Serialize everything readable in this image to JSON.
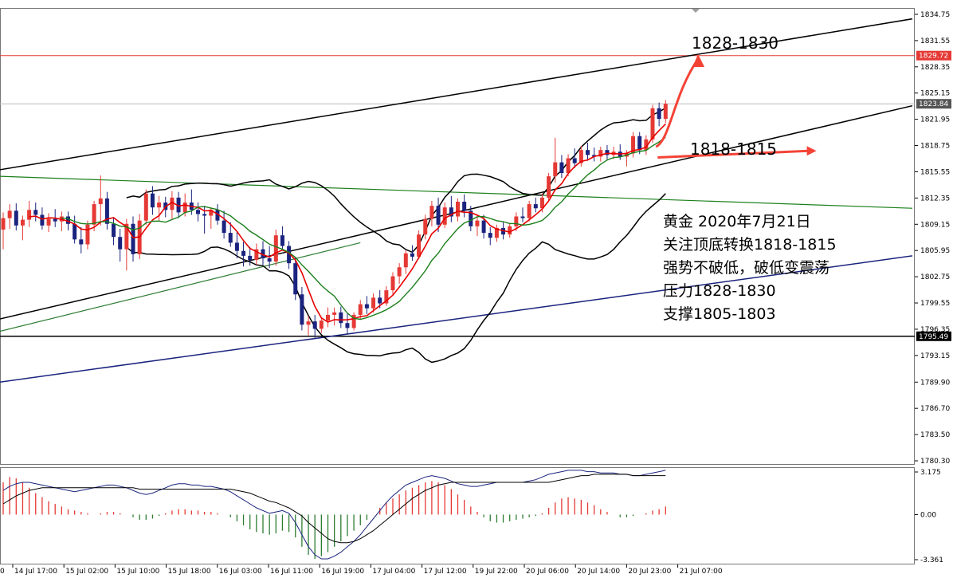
{
  "chart_data": {
    "type": "candlestick",
    "instrument_note": "黄金 2020年7月21日",
    "price_axis": {
      "ticks": [
        "1834.75",
        "1831.55",
        "1828.35",
        "1825.15",
        "1821.95",
        "1818.75",
        "1815.55",
        "1812.35",
        "1809.15",
        "1805.95",
        "1802.75",
        "1799.55",
        "1796.35",
        "1793.15",
        "1789.90",
        "1786.70",
        "1783.50",
        "1780.30"
      ],
      "range": [
        1780.3,
        1834.75
      ]
    },
    "time_axis": {
      "ticks": [
        "14 Jul 17:00",
        "15 Jul 02:00",
        "15 Jul 10:00",
        "15 Jul 18:00",
        "16 Jul 03:00",
        "16 Jul 11:00",
        "16 Jul 19:00",
        "17 Jul 04:00",
        "17 Jul 12:00",
        "19 Jul 22:00",
        "20 Jul 06:00",
        "20 Jul 14:00",
        "20 Jul 23:00",
        "21 Jul 07:00"
      ],
      "first_partial": "0"
    },
    "price_tags": [
      {
        "label": "1829.72",
        "value": 1829.72,
        "color": "#e53935"
      },
      {
        "label": "1823.84",
        "value": 1823.84,
        "color": "#555555"
      },
      {
        "label": "1795.49",
        "value": 1795.49,
        "color": "#000000"
      }
    ],
    "horizontal_lines": [
      {
        "value": 1829.72,
        "color": "#e53935"
      },
      {
        "value": 1823.84,
        "color": "#bbbbbb"
      },
      {
        "value": 1795.49,
        "color": "#000000"
      }
    ],
    "candles": [
      [
        1808.5,
        1810.6,
        1806.1,
        1809.9
      ],
      [
        1809.9,
        1811.6,
        1808.6,
        1810.8
      ],
      [
        1810.8,
        1811.7,
        1808.4,
        1809.0
      ],
      [
        1809.0,
        1810.2,
        1807.2,
        1809.7
      ],
      [
        1809.7,
        1812.0,
        1808.8,
        1810.9
      ],
      [
        1810.9,
        1811.8,
        1809.5,
        1810.3
      ],
      [
        1810.3,
        1811.2,
        1808.5,
        1809.0
      ],
      [
        1809.0,
        1810.5,
        1808.2,
        1809.8
      ],
      [
        1809.8,
        1811.0,
        1808.8,
        1809.5
      ],
      [
        1809.5,
        1810.7,
        1808.3,
        1810.1
      ],
      [
        1810.1,
        1810.7,
        1808.4,
        1809.2
      ],
      [
        1809.2,
        1810.2,
        1806.8,
        1807.3
      ],
      [
        1807.3,
        1808.8,
        1805.6,
        1806.7
      ],
      [
        1806.7,
        1809.6,
        1806.1,
        1809.1
      ],
      [
        1809.1,
        1812.0,
        1808.3,
        1811.6
      ],
      [
        1811.6,
        1815.1,
        1809.0,
        1812.3
      ],
      [
        1812.3,
        1813.1,
        1808.5,
        1809.2
      ],
      [
        1809.2,
        1810.0,
        1806.6,
        1807.6
      ],
      [
        1807.6,
        1808.6,
        1804.6,
        1806.1
      ],
      [
        1806.1,
        1809.8,
        1803.5,
        1809.2
      ],
      [
        1809.2,
        1810.1,
        1804.6,
        1805.5
      ],
      [
        1805.5,
        1810.4,
        1804.9,
        1809.6
      ],
      [
        1809.6,
        1813.4,
        1809.1,
        1812.9
      ],
      [
        1812.9,
        1813.8,
        1810.3,
        1811.2
      ],
      [
        1811.2,
        1812.6,
        1809.5,
        1811.8
      ],
      [
        1811.8,
        1812.5,
        1810.0,
        1810.9
      ],
      [
        1810.9,
        1813.2,
        1809.8,
        1812.4
      ],
      [
        1812.4,
        1813.1,
        1809.9,
        1810.6
      ],
      [
        1810.6,
        1812.9,
        1810.1,
        1811.8
      ],
      [
        1811.8,
        1813.4,
        1810.3,
        1810.9
      ],
      [
        1810.9,
        1811.8,
        1809.5,
        1810.4
      ],
      [
        1810.4,
        1811.4,
        1808.0,
        1810.2
      ],
      [
        1810.2,
        1811.2,
        1808.6,
        1810.9
      ],
      [
        1810.9,
        1811.6,
        1809.1,
        1809.6
      ],
      [
        1809.6,
        1810.8,
        1807.4,
        1808.1
      ],
      [
        1808.1,
        1809.4,
        1806.4,
        1806.9
      ],
      [
        1806.9,
        1808.3,
        1805.0,
        1805.9
      ],
      [
        1805.9,
        1807.0,
        1804.0,
        1805.3
      ],
      [
        1805.3,
        1806.4,
        1804.1,
        1804.8
      ],
      [
        1804.8,
        1806.8,
        1804.2,
        1806.1
      ],
      [
        1806.1,
        1807.1,
        1804.2,
        1805.0
      ],
      [
        1805.0,
        1806.5,
        1803.8,
        1804.6
      ],
      [
        1804.6,
        1808.5,
        1804.1,
        1807.8
      ],
      [
        1807.8,
        1808.9,
        1806.0,
        1806.5
      ],
      [
        1806.5,
        1807.1,
        1803.7,
        1804.4
      ],
      [
        1804.4,
        1805.2,
        1799.9,
        1800.6
      ],
      [
        1800.6,
        1801.5,
        1796.2,
        1796.9
      ],
      [
        1796.9,
        1798.0,
        1795.6,
        1797.3
      ],
      [
        1797.3,
        1798.1,
        1795.3,
        1796.4
      ],
      [
        1796.4,
        1797.8,
        1795.9,
        1797.4
      ],
      [
        1797.4,
        1799.0,
        1796.6,
        1798.1
      ],
      [
        1798.1,
        1799.0,
        1796.8,
        1798.4
      ],
      [
        1798.4,
        1799.1,
        1796.5,
        1797.1
      ],
      [
        1797.1,
        1798.3,
        1795.8,
        1796.5
      ],
      [
        1796.5,
        1798.4,
        1796.2,
        1798.1
      ],
      [
        1798.1,
        1799.9,
        1797.5,
        1799.4
      ],
      [
        1799.4,
        1800.4,
        1798.2,
        1798.9
      ],
      [
        1798.9,
        1800.7,
        1798.4,
        1800.2
      ],
      [
        1800.2,
        1801.1,
        1798.9,
        1799.5
      ],
      [
        1799.5,
        1801.6,
        1799.2,
        1801.1
      ],
      [
        1801.1,
        1803.3,
        1800.5,
        1802.8
      ],
      [
        1802.8,
        1804.4,
        1801.9,
        1803.9
      ],
      [
        1803.9,
        1806.0,
        1803.1,
        1805.6
      ],
      [
        1805.6,
        1806.6,
        1804.7,
        1805.2
      ],
      [
        1805.2,
        1808.4,
        1804.9,
        1807.9
      ],
      [
        1807.9,
        1810.3,
        1807.3,
        1809.8
      ],
      [
        1809.8,
        1812.0,
        1808.9,
        1811.4
      ],
      [
        1811.4,
        1812.4,
        1808.2,
        1809.1
      ],
      [
        1809.1,
        1811.8,
        1808.7,
        1811.2
      ],
      [
        1811.2,
        1812.6,
        1809.4,
        1810.1
      ],
      [
        1810.1,
        1812.3,
        1809.5,
        1811.9
      ],
      [
        1811.9,
        1812.8,
        1810.0,
        1810.8
      ],
      [
        1810.8,
        1811.4,
        1808.3,
        1808.9
      ],
      [
        1808.9,
        1810.2,
        1807.7,
        1809.6
      ],
      [
        1809.6,
        1810.3,
        1807.4,
        1808.1
      ],
      [
        1808.1,
        1808.8,
        1806.6,
        1807.5
      ],
      [
        1807.5,
        1809.1,
        1807.0,
        1808.7
      ],
      [
        1808.7,
        1809.4,
        1807.3,
        1807.9
      ],
      [
        1807.9,
        1809.3,
        1807.5,
        1808.9
      ],
      [
        1808.9,
        1810.6,
        1808.3,
        1810.1
      ],
      [
        1810.1,
        1811.2,
        1809.4,
        1809.9
      ],
      [
        1809.9,
        1812.0,
        1809.5,
        1811.6
      ],
      [
        1811.6,
        1812.4,
        1810.6,
        1811.1
      ],
      [
        1811.1,
        1812.9,
        1810.6,
        1812.4
      ],
      [
        1812.4,
        1815.4,
        1812.1,
        1815.0
      ],
      [
        1815.0,
        1819.7,
        1814.2,
        1816.7
      ],
      [
        1816.7,
        1817.6,
        1814.8,
        1815.4
      ],
      [
        1815.4,
        1817.7,
        1815.0,
        1817.2
      ],
      [
        1817.2,
        1818.4,
        1816.0,
        1816.6
      ],
      [
        1816.6,
        1818.7,
        1816.2,
        1818.2
      ],
      [
        1818.2,
        1819.1,
        1816.9,
        1817.6
      ],
      [
        1817.6,
        1818.5,
        1816.8,
        1817.4
      ],
      [
        1817.4,
        1818.6,
        1816.8,
        1818.2
      ],
      [
        1818.2,
        1818.8,
        1817.0,
        1817.6
      ],
      [
        1817.6,
        1818.6,
        1817.1,
        1818.0
      ],
      [
        1818.0,
        1818.9,
        1817.0,
        1817.4
      ],
      [
        1817.4,
        1818.2,
        1816.2,
        1817.8
      ],
      [
        1817.8,
        1820.4,
        1817.3,
        1819.9
      ],
      [
        1819.9,
        1820.4,
        1817.7,
        1818.2
      ],
      [
        1818.2,
        1820.0,
        1817.6,
        1819.5
      ],
      [
        1819.5,
        1823.7,
        1819.1,
        1823.3
      ],
      [
        1823.3,
        1824.0,
        1821.1,
        1822.0
      ],
      [
        1822.0,
        1824.3,
        1821.5,
        1823.84
      ]
    ],
    "indicators": [
      "MA(5) red",
      "MA(10) green",
      "Bollinger Bands black",
      "trend lines"
    ],
    "macd": {
      "ticks": [
        "3.175",
        "0.00",
        "-3.361"
      ],
      "range": [
        -3.361,
        3.175
      ],
      "histogram": [
        2.4,
        2.8,
        2.7,
        2.4,
        2.0,
        1.6,
        1.3,
        1.0,
        0.8,
        0.6,
        0.4,
        0.3,
        0.2,
        0.1,
        0.0,
        0.1,
        0.2,
        0.2,
        0.1,
        0.0,
        -0.2,
        -0.4,
        -0.4,
        -0.3,
        -0.1,
        0.1,
        0.3,
        0.4,
        0.4,
        0.3,
        0.3,
        0.2,
        0.2,
        0.1,
        0.0,
        -0.2,
        -0.5,
        -0.8,
        -1.1,
        -1.3,
        -1.4,
        -1.5,
        -1.4,
        -1.2,
        -1.3,
        -1.7,
        -2.4,
        -3.0,
        -3.3,
        -3.1,
        -2.8,
        -2.4,
        -2.0,
        -1.6,
        -1.2,
        -0.8,
        -0.4,
        0.0,
        0.5,
        0.9,
        1.2,
        1.5,
        1.8,
        2.0,
        2.2,
        2.4,
        2.5,
        2.4,
        2.2,
        1.9,
        1.5,
        1.1,
        0.6,
        0.2,
        -0.2,
        -0.5,
        -0.6,
        -0.6,
        -0.5,
        -0.4,
        -0.3,
        -0.2,
        -0.1,
        0.1,
        0.5,
        0.9,
        1.2,
        1.3,
        1.2,
        1.1,
        0.9,
        0.7,
        0.4,
        0.2,
        0.0,
        -0.2,
        -0.2,
        -0.1,
        0.0,
        0.1,
        0.3,
        0.4,
        0.6
      ],
      "macd_line": [
        1.8,
        2.1,
        2.3,
        2.4,
        2.4,
        2.3,
        2.2,
        2.1,
        2.0,
        1.9,
        1.8,
        1.7,
        1.8,
        1.9,
        2.0,
        2.1,
        2.2,
        2.2,
        2.1,
        2.0,
        1.8,
        1.6,
        1.5,
        1.6,
        1.8,
        2.0,
        2.2,
        2.3,
        2.3,
        2.2,
        2.2,
        2.1,
        2.1,
        2.0,
        1.9,
        1.7,
        1.4,
        1.1,
        0.8,
        0.5,
        0.3,
        0.1,
        0.2,
        0.3,
        0.1,
        -0.6,
        -1.5,
        -2.4,
        -3.0,
        -3.3,
        -3.3,
        -3.1,
        -2.8,
        -2.4,
        -2.0,
        -1.5,
        -0.9,
        -0.3,
        0.3,
        0.9,
        1.4,
        1.8,
        2.2,
        2.4,
        2.6,
        2.8,
        2.9,
        2.8,
        2.7,
        2.5,
        2.3,
        2.2,
        2.1,
        2.1,
        2.2,
        2.3,
        2.4,
        2.4,
        2.4,
        2.4,
        2.4,
        2.5,
        2.6,
        2.8,
        3.0,
        3.1,
        3.2,
        3.3,
        3.3,
        3.3,
        3.2,
        3.2,
        3.1,
        3.1,
        3.1,
        3.0,
        3.0,
        2.9,
        2.9,
        3.0,
        3.1,
        3.2,
        3.3
      ],
      "signal_line": [
        0.8,
        1.1,
        1.4,
        1.6,
        1.8,
        1.9,
        2.0,
        2.0,
        2.0,
        2.0,
        2.0,
        2.0,
        2.0,
        2.0,
        2.0,
        2.0,
        2.0,
        2.0,
        2.0,
        2.0,
        2.0,
        1.9,
        1.9,
        1.9,
        1.9,
        1.9,
        1.9,
        1.9,
        1.9,
        1.9,
        1.9,
        1.9,
        1.9,
        1.9,
        1.9,
        1.9,
        1.8,
        1.7,
        1.6,
        1.4,
        1.2,
        1.0,
        0.9,
        0.7,
        0.5,
        0.2,
        -0.1,
        -0.6,
        -1.0,
        -1.4,
        -1.8,
        -2.0,
        -2.1,
        -2.1,
        -2.0,
        -1.8,
        -1.5,
        -1.2,
        -0.8,
        -0.4,
        0.0,
        0.4,
        0.8,
        1.2,
        1.5,
        1.8,
        2.0,
        2.2,
        2.3,
        2.4,
        2.4,
        2.4,
        2.4,
        2.4,
        2.4,
        2.4,
        2.4,
        2.4,
        2.4,
        2.4,
        2.4,
        2.4,
        2.4,
        2.4,
        2.4,
        2.5,
        2.6,
        2.7,
        2.8,
        2.9,
        2.9,
        3.0,
        3.0,
        3.0,
        3.0,
        3.0,
        3.0,
        2.9,
        2.9,
        2.9,
        2.9,
        2.9,
        2.9
      ]
    }
  },
  "annotations": {
    "target_label": "1828-1830",
    "support_zone_label": "1818-1815",
    "note_lines": [
      "黄金 2020年7月21日",
      "关注顶底转换1818-1815",
      "强势不破低，破低变震荡",
      "压力1828-1830",
      "支撑1805-1803"
    ]
  },
  "colors": {
    "bull": "#e53935",
    "bear": "#1a237e",
    "ma_fast": "#e60000",
    "ma_slow": "#1b7f1b",
    "bands": "#000000",
    "trend_green": "#2e7d32",
    "trend_navy": "#1a237e",
    "macd_hist_up": "#e53935",
    "macd_hist_down": "#2e7d32",
    "macd_line": "#1a237e",
    "signal_line": "#000000",
    "arrow": "#f44336"
  }
}
